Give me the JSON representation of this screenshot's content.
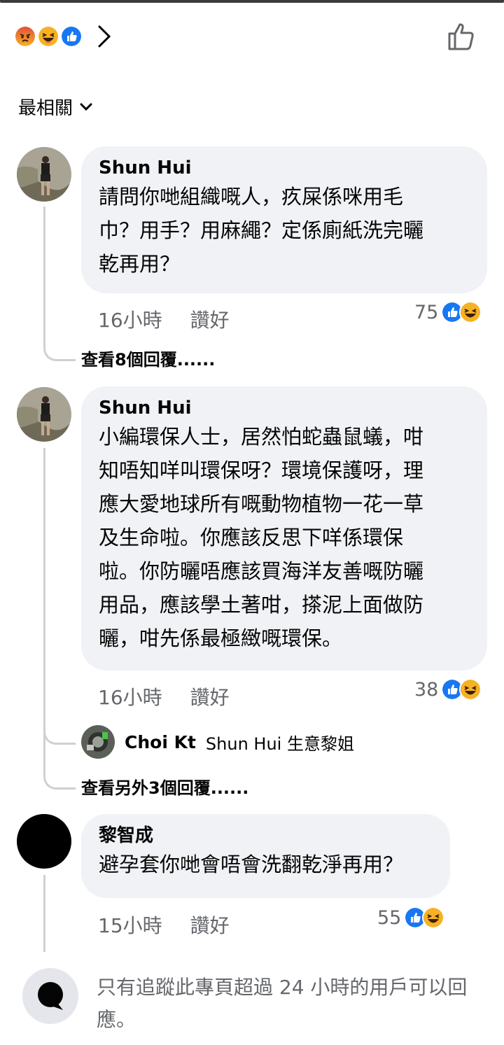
{
  "header": {
    "reactions": [
      "angry-icon",
      "haha-icon",
      "like-icon"
    ],
    "colors": {
      "like": "#1877f2",
      "angry": "#e9710f",
      "haha": "#f7b125"
    }
  },
  "sort": {
    "label": "最相關"
  },
  "comments": [
    {
      "author": "Shun Hui",
      "text": "請問你哋組織嘅人，疚屎係咪用毛\n巾？用手？用麻繩？定係廁紙洗完曬\n乾再用？",
      "time": "16小時",
      "like_label": "讚好",
      "reaction_count": "75",
      "more_replies": "查看8個回覆......"
    },
    {
      "author": "Shun Hui",
      "text": "小編環保人士，居然怕蛇蟲鼠蟻，咁\n知唔知咩叫環保呀？環境保護呀，理\n應大愛地球所有嘅動物植物一花一草\n及生命啦。你應該反思下咩係環保\n啦。你防曬唔應該買海洋友善嘅防曬\n用品，應該學土著咁，搽泥上面做防\n曬，咁先係最極緻嘅環保。",
      "time": "16小時",
      "like_label": "讚好",
      "reaction_count": "38",
      "reply": {
        "author": "Choi Kt",
        "text": "Shun Hui 生意黎姐"
      },
      "more_replies": "查看另外3個回覆......"
    },
    {
      "author": "黎智成",
      "text": "避孕套你哋會唔會洗翻乾淨再用？",
      "time": "15小時",
      "like_label": "讚好",
      "reaction_count": "55"
    }
  ],
  "footer": {
    "notice": "只有追蹤此專頁超過 24 小時的用戶可以回應。"
  }
}
